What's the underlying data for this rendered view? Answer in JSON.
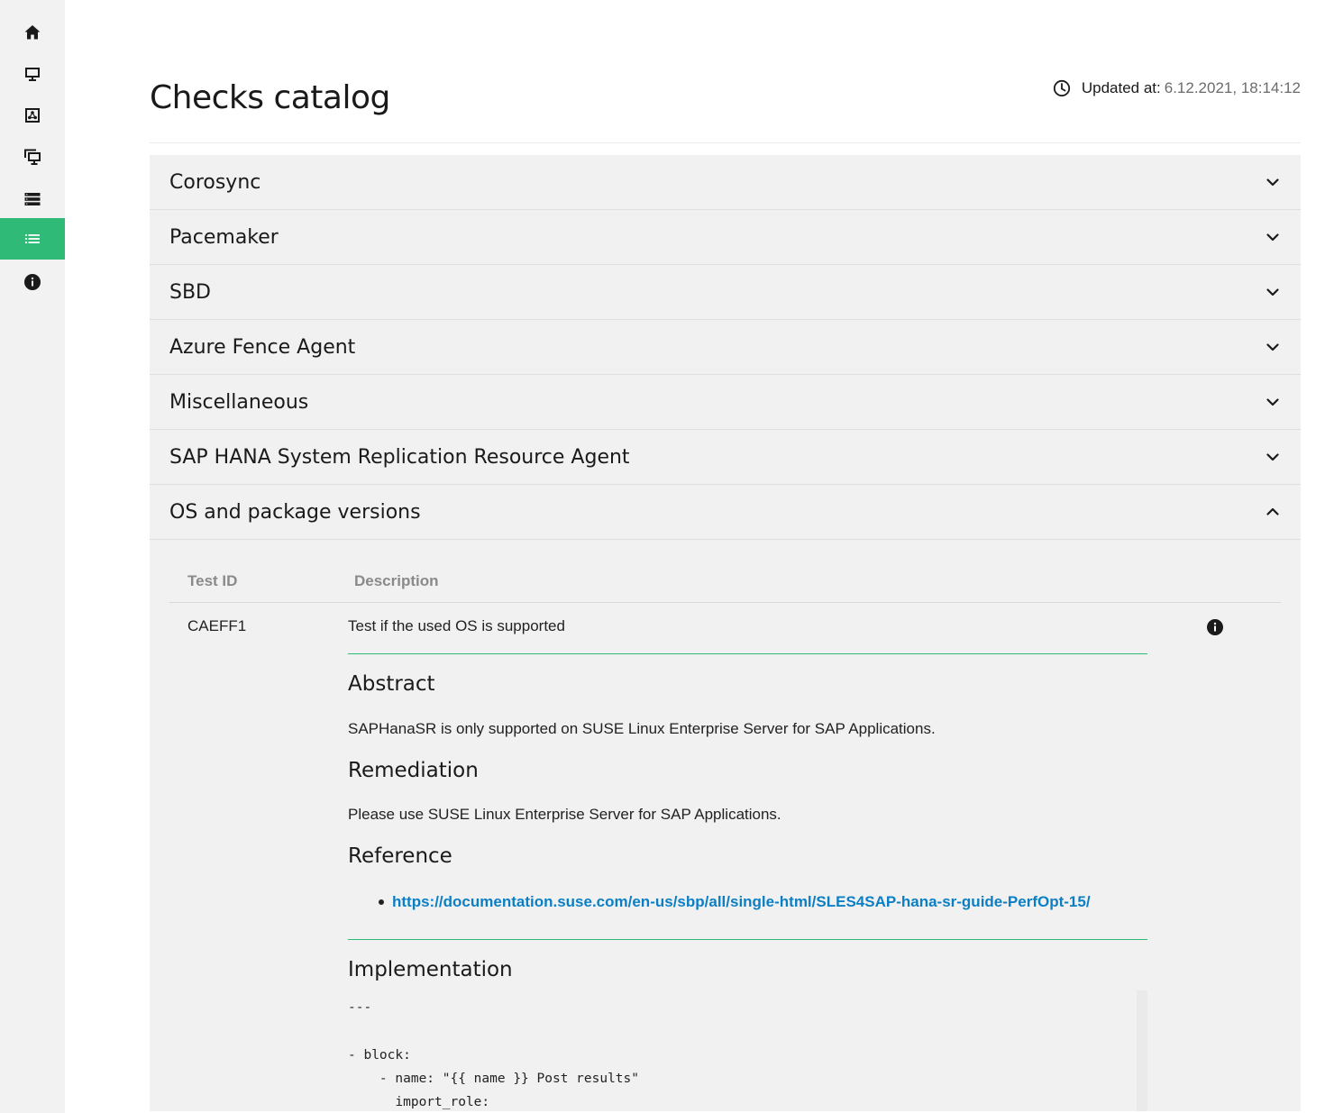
{
  "sidebar": {
    "items": [
      {
        "icon": "home-icon",
        "label": "Home"
      },
      {
        "icon": "monitor-icon",
        "label": "Hosts"
      },
      {
        "icon": "network-icon",
        "label": "Clusters"
      },
      {
        "icon": "screens-icon",
        "label": "SAP Systems"
      },
      {
        "icon": "server-stack-icon",
        "label": "HANA Databases"
      },
      {
        "icon": "list-icon",
        "label": "Checks catalog",
        "active": true
      },
      {
        "icon": "info-icon",
        "label": "About"
      }
    ],
    "active_color": "#30ba78"
  },
  "header": {
    "title": "Checks catalog",
    "updated_label": "Updated at:",
    "updated_value": "6.12.2021, 18:14:12"
  },
  "accordion": [
    {
      "title": "Corosync",
      "expanded": false
    },
    {
      "title": "Pacemaker",
      "expanded": false
    },
    {
      "title": "SBD",
      "expanded": false
    },
    {
      "title": "Azure Fence Agent",
      "expanded": false
    },
    {
      "title": "Miscellaneous",
      "expanded": false
    },
    {
      "title": "SAP HANA System Replication Resource Agent",
      "expanded": false
    },
    {
      "title": "OS and package versions",
      "expanded": true
    }
  ],
  "table": {
    "col_id": "Test ID",
    "col_desc": "Description",
    "row": {
      "id": "CAEFF1",
      "description": "Test if the used OS is supported"
    }
  },
  "details": {
    "abstract_heading": "Abstract",
    "abstract_text": "SAPHanaSR is only supported on SUSE Linux Enterprise Server for SAP Applications.",
    "remediation_heading": "Remediation",
    "remediation_text": "Please use SUSE Linux Enterprise Server for SAP Applications.",
    "reference_heading": "Reference",
    "reference_link": "https://documentation.suse.com/en-us/sbp/all/single-html/SLES4SAP-hana-sr-guide-PerfOpt-15/",
    "implementation_heading": "Implementation",
    "implementation_code": "---\n\n- block:\n    - name: \"{{ name }} Post results\"\n      import_role:"
  }
}
